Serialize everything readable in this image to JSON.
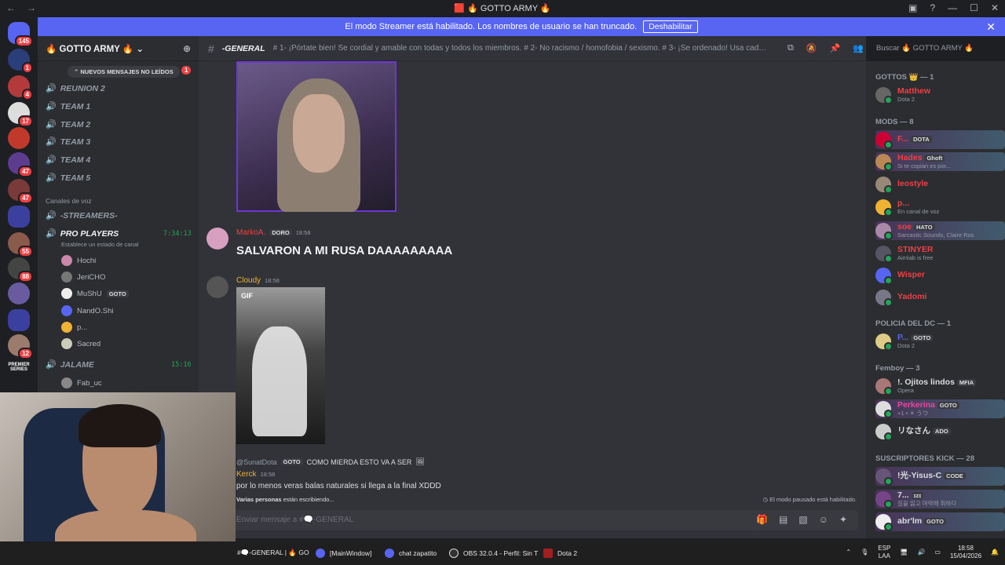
{
  "window": {
    "title": "🟥 🔥 GOTTO ARMY 🔥"
  },
  "banner": {
    "text": "El modo Streamer está habilitado. Los nombres de usuario se han truncado.",
    "button": "Deshabilitar"
  },
  "guilds": {
    "badges": [
      "145",
      "1",
      "4",
      "17",
      "47",
      "47",
      "55",
      "88",
      "12"
    ],
    "premier_label": "PREMIER SERIES"
  },
  "server": {
    "name": "🔥 GOTTO ARMY 🔥"
  },
  "channels": {
    "new_messages_pill": "NUEVOS MENSAJES NO LEÍDOS",
    "pill_badge": "1",
    "items": [
      "REUNION 2",
      "TEAM 1",
      "TEAM 2",
      "TEAM 3",
      "TEAM 4",
      "TEAM 5"
    ],
    "voice_category": "Canales de voz",
    "streamers": "-STREAMERS-",
    "pro_players": "PRO PLAYERS",
    "pro_players_time": "7:34:13",
    "status_hint": "Establece un estado de canal",
    "users": [
      "Hochi",
      "JeriCHO",
      "MuShU",
      "NandO.Shi",
      "p...",
      "Sacred"
    ],
    "mushu_tag": "GOTO",
    "jalame": "JALAME",
    "jalame_time": "15:16",
    "jalame_user": "Fab_uc"
  },
  "chat": {
    "channel_name": "-GENERAL",
    "topic": "# 1- ¡Pórtate bien! Se cordial y amable con todas y todos los miembros. # 2- No racismo / homofobia / sexismo. # 3- ¡Se ordenado! Usa cada canal para su r...",
    "search_placeholder": "Buscar 🔥 GOTTO ARMY 🔥",
    "messages": [
      {
        "author": "MarkoA.",
        "tag": "DORO",
        "time": "18:58",
        "text": "SALVARON A MI RUSA DAAAAAAAAA"
      },
      {
        "author": "Cloudy",
        "time": "18:58",
        "gif_label": "GIF"
      },
      {
        "reply_to": "@SunatDota",
        "reply_tag": "GOTO",
        "reply_text": "COMO MIERDA ESTO VA A SER"
      },
      {
        "author": "Kerck",
        "time": "18:58",
        "text": "por lo menos veras balas naturales si llega a la final XDDD"
      }
    ],
    "typing_users": "Varias personas",
    "typing_suffix": "están escribiendo...",
    "slowmode": "El modo pausado está habilitado.",
    "composer_placeholder": "Enviar mensaje a #🗨️-GENERAL"
  },
  "members": {
    "sections": [
      {
        "title": "GOTTOS 👑 — 1"
      },
      {
        "title": "MODS — 8"
      },
      {
        "title": "POLICIA DEL DC — 1"
      },
      {
        "title": "Femboy — 3"
      },
      {
        "title": "SUSCRIPTORES KICK — 28"
      }
    ],
    "list": [
      {
        "name": "Matthew",
        "status": "Dota 2",
        "color": "#f23f43"
      },
      {
        "name": "F...",
        "status": "",
        "tag": "DOTA",
        "color": "#f23f43"
      },
      {
        "name": "Hades",
        "status": "Si te copian es por...",
        "tag": "Ghoft",
        "color": "#f23f43"
      },
      {
        "name": "leostyle",
        "status": "",
        "color": "#f23f43"
      },
      {
        "name": "p...",
        "status": "En canal de voz",
        "color": "#f23f43"
      },
      {
        "name": "soe",
        "status": "Sarcastic Sounds, Claire Ros",
        "tag": "HATO",
        "color": "#f23f43"
      },
      {
        "name": "STINYER",
        "status": "Aimlab is free",
        "color": "#f23f43"
      },
      {
        "name": "Wisper",
        "status": "",
        "color": "#f23f43"
      },
      {
        "name": "Yadomi",
        "status": "",
        "color": "#f23f43"
      },
      {
        "name": "P...",
        "status": "Dota 2",
        "tag": "GOTO",
        "color": "#5865f2"
      },
      {
        "name": "!. Ojitos lindos",
        "status": "Opera",
        "tag": "MFIA",
        "color": "#dbdee1"
      },
      {
        "name": "Perkerina",
        "status": "+1 • ☀ うつ",
        "tag": "GOTO",
        "color": "#eb459e"
      },
      {
        "name": "リなさん",
        "status": "",
        "tag": "ADO",
        "color": "#dbdee1"
      },
      {
        "name": "!光-Yisus-C",
        "status": "",
        "tag": "CODE",
        "color": "#dbdee1"
      },
      {
        "name": "7...",
        "status": "길을 잃고 마약에 취하다",
        "tag": "ɪᴢɪ",
        "color": "#dbdee1"
      },
      {
        "name": "abr'lm",
        "status": "",
        "tag": "GOTO",
        "color": "#dbdee1"
      }
    ]
  },
  "taskbar": {
    "items": [
      "#🗨️-GENERAL | 🔥 GO",
      "[MainWindow]",
      "chat zapatito",
      "OBS 32.0.4 - Perfil: Sin T",
      "Dota 2"
    ],
    "lang": "ESP",
    "lang2": "LAA",
    "time": "18:58",
    "date": "15/04/2026"
  }
}
